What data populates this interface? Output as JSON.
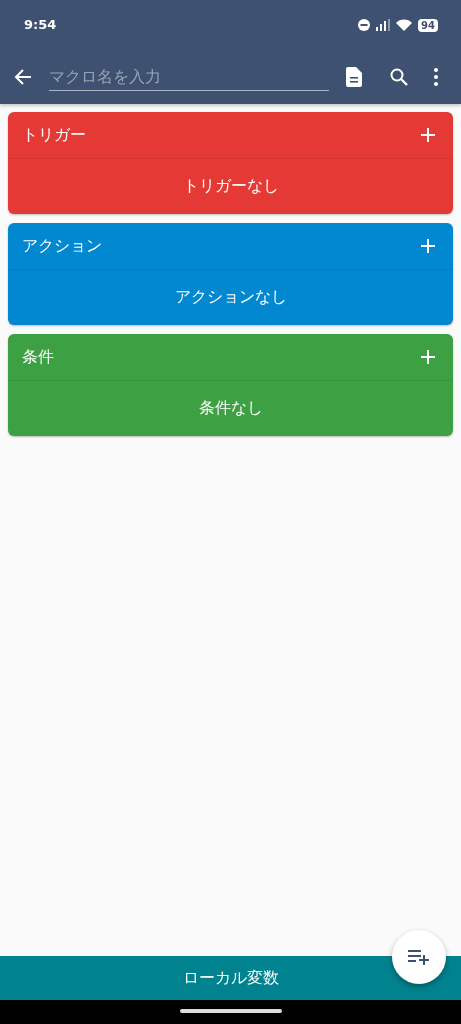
{
  "status_bar": {
    "time": "9:54",
    "battery": "94"
  },
  "toolbar": {
    "placeholder": "マクロ名を入力"
  },
  "sections": [
    {
      "title": "トリガー",
      "empty_text": "トリガーなし",
      "color": "#e53935"
    },
    {
      "title": "アクション",
      "empty_text": "アクションなし",
      "color": "#0288d1"
    },
    {
      "title": "条件",
      "empty_text": "条件なし",
      "color": "#3da042"
    }
  ],
  "bottom_bar": {
    "label": "ローカル変数"
  }
}
